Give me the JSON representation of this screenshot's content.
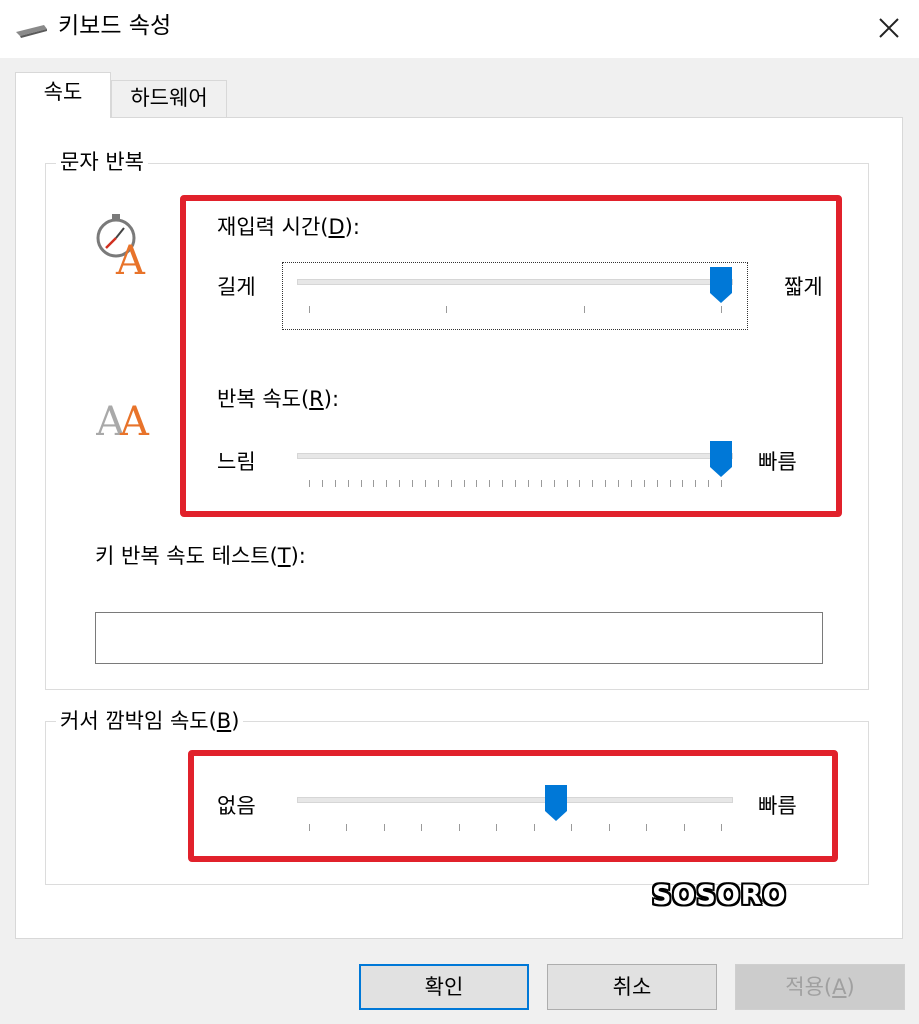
{
  "window": {
    "title": "키보드 속성"
  },
  "tabs": [
    {
      "label": "속도",
      "active": true
    },
    {
      "label": "하드웨어",
      "active": false
    }
  ],
  "char_repeat": {
    "group_title": "문자 반복",
    "delay": {
      "label_prefix": "재입력 시간(",
      "label_key": "D",
      "label_suffix": "):",
      "min_label": "길게",
      "max_label": "짧게",
      "value_fraction": 1.0
    },
    "rate": {
      "label_prefix": "반복 속도(",
      "label_key": "R",
      "label_suffix": "):",
      "min_label": "느림",
      "max_label": "빠름",
      "value_fraction": 1.0
    },
    "test": {
      "label_prefix": "키 반복 속도 테스트(",
      "label_key": "T",
      "label_suffix": "):",
      "value": ""
    }
  },
  "cursor_blink": {
    "group_title_prefix": "커서 깜박임 속도(",
    "group_title_key": "B",
    "group_title_suffix": ")",
    "min_label": "없음",
    "max_label": "빠름",
    "value_fraction": 0.6
  },
  "buttons": {
    "ok": "확인",
    "cancel": "취소",
    "apply_prefix": "적용(",
    "apply_key": "A",
    "apply_suffix": ")"
  },
  "watermark": "SOSORO",
  "colors": {
    "highlight": "#e1212b",
    "thumb": "#0078d7",
    "default_button_border": "#0078d7"
  }
}
